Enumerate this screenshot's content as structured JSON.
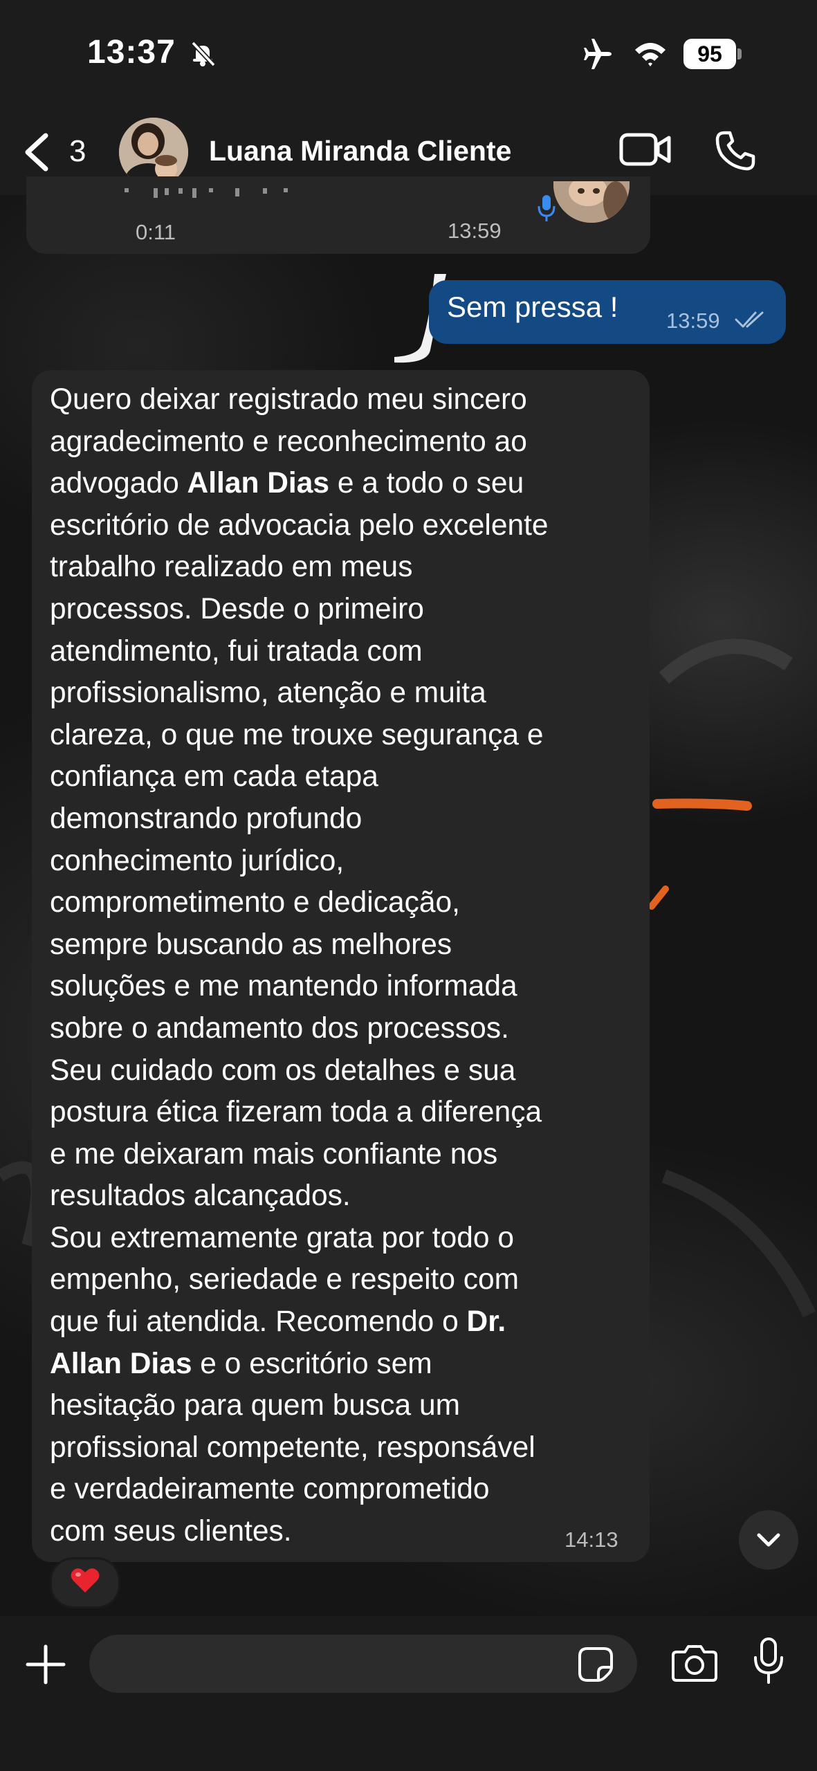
{
  "status_bar": {
    "time": "13:37",
    "battery": "95"
  },
  "header": {
    "back_count": "3",
    "contact_name": "Luana Miranda Cliente"
  },
  "messages": {
    "voice": {
      "duration": "0:11",
      "time": "13:59"
    },
    "sent": {
      "text": "Sem pressa !",
      "time": "13:59"
    },
    "received": {
      "lines": [
        "Quero deixar registrado meu sincero",
        "agradecimento e reconhecimento ao",
        "advogado ",
        "Allan Dias",
        " e a todo o seu",
        "escritório de advocacia pelo excelente",
        "trabalho realizado em meus",
        "processos. Desde o primeiro",
        "atendimento, fui tratada com",
        "profissionalismo, atenção e muita",
        "clareza, o que me trouxe segurança e",
        "confiança em cada etapa",
        "demonstrando profundo",
        "conhecimento jurídico,",
        "comprometimento e dedicação,",
        "sempre buscando as melhores",
        "soluções e me mantendo informada",
        "sobre o andamento dos processos.",
        "Seu cuidado com os detalhes e sua",
        "postura ética fizeram toda a diferença",
        "e me deixaram mais confiante nos",
        "resultados alcançados.",
        "Sou extremamente grata por todo o",
        "empenho, seriedade e respeito com",
        "que fui atendida. Recomendo o  ",
        "Dr.",
        "Allan Dias",
        " e o escritório sem",
        "hesitação para quem busca um",
        "profissional competente, responsável",
        "e verdadeiramente comprometido",
        "com seus clientes."
      ],
      "time": "14:13",
      "reaction": "❤️"
    }
  },
  "colors": {
    "incoming_bubble": "#262626",
    "outgoing_bubble": "#134a83",
    "bars": "#1c1c1c",
    "voice_mic": "#3b8cf0"
  },
  "icons": [
    "bell-off-icon",
    "airplane-icon",
    "wifi-icon",
    "battery-icon",
    "chevron-left-icon",
    "video-camera-icon",
    "phone-icon",
    "microphone-icon",
    "double-check-icon",
    "chevron-down-icon",
    "plus-icon",
    "sticker-icon",
    "camera-icon"
  ]
}
